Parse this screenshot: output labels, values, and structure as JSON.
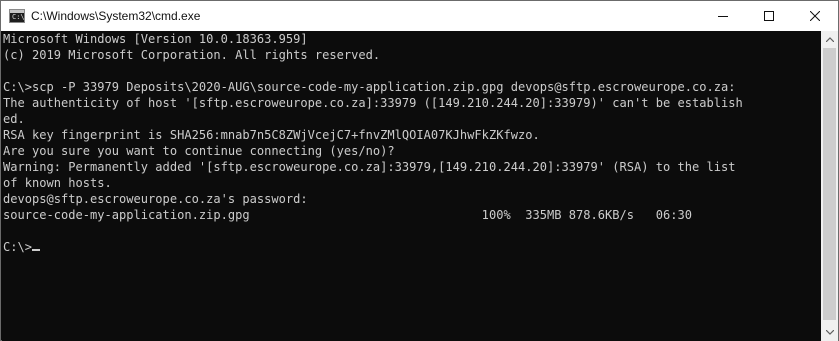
{
  "window": {
    "title": "C:\\Windows\\System32\\cmd.exe",
    "app_icon_glyph": "C:\\",
    "icon_names": [
      "cmd-app-icon",
      "minimize-icon",
      "maximize-icon",
      "close-icon"
    ]
  },
  "console": {
    "lines": [
      "Microsoft Windows [Version 10.0.18363.959]",
      "(c) 2019 Microsoft Corporation. All rights reserved.",
      "",
      "C:\\>scp -P 33979 Deposits\\2020-AUG\\source-code-my-application.zip.gpg devops@sftp.escroweurope.co.za:",
      "The authenticity of host '[sftp.escroweurope.co.za]:33979 ([149.210.244.20]:33979)' can't be establish",
      "ed.",
      "RSA key fingerprint is SHA256:mnab7n5C8ZWjVcejC7+fnvZMlQOIA07KJhwFkZKfwzo.",
      "Are you sure you want to continue connecting (yes/no)?",
      "Warning: Permanently added '[sftp.escroweurope.co.za]:33979,[149.210.244.20]:33979' (RSA) to the list",
      "of known hosts.",
      "devops@sftp.escroweurope.co.za's password:",
      "source-code-my-application.zip.gpg                                100%  335MB 878.6KB/s   06:30",
      "",
      "C:\\>"
    ]
  },
  "colors": {
    "console_bg": "#0c0c0c",
    "console_text": "#cccccc",
    "titlebar_bg": "#ffffff"
  }
}
